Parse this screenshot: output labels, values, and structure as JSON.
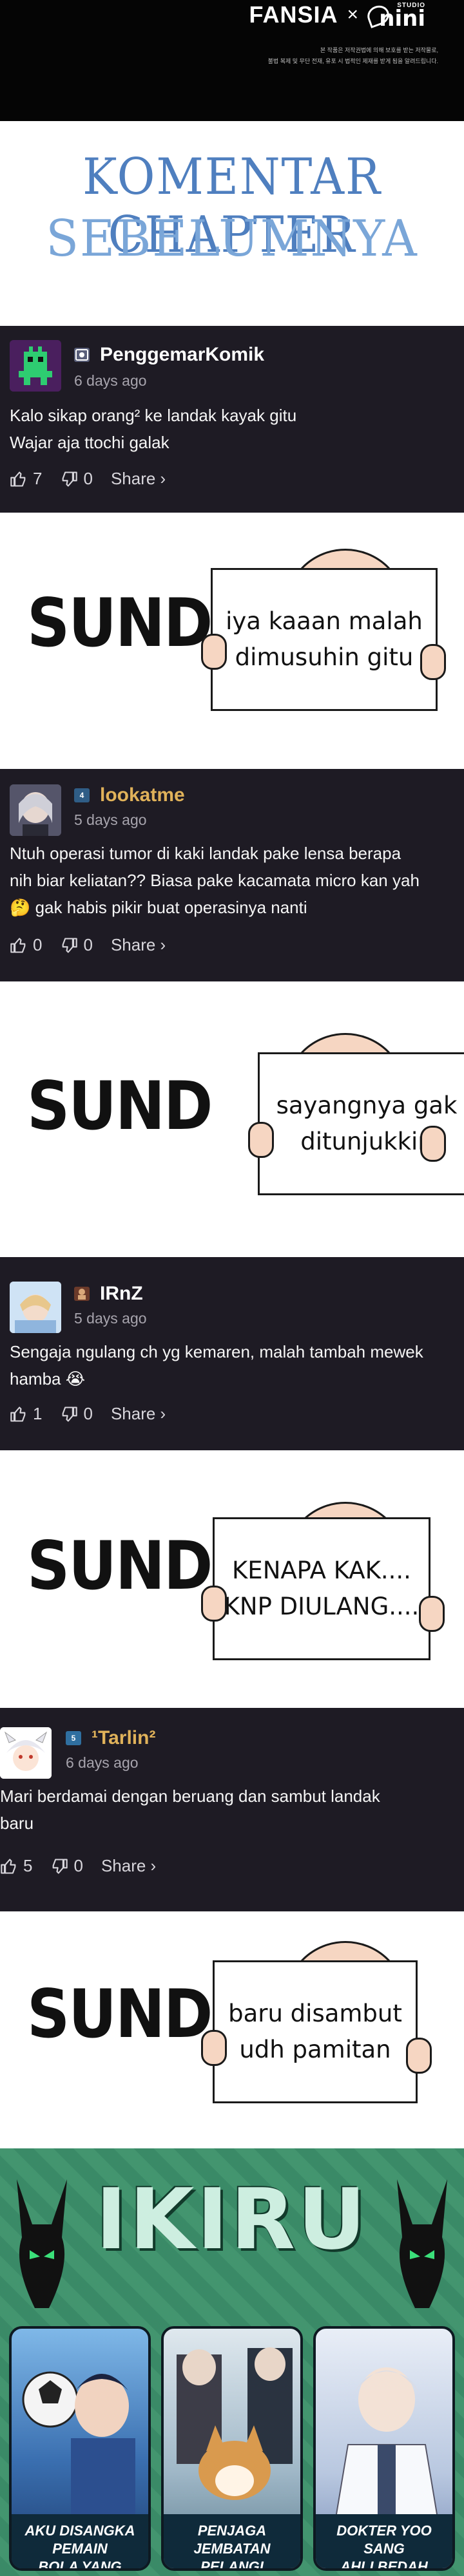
{
  "banner": {
    "brand": "FANSIA",
    "separator": "×",
    "studio_top": "STUDIO",
    "studio_name": "nini",
    "notes": [
      "본 작품은 저작권법에 의해 보호를 받는 저작물로,",
      "불법 복제 및 무단 전재, 유포 시 법적인 제재를 받게 됨을 알려드립니다."
    ]
  },
  "title": {
    "line1": "KOMENTAR CHAPTER",
    "line2": "SEBELUMNYA"
  },
  "comments": [
    {
      "username": "PenggemarKomik",
      "age": "6 days ago",
      "text": [
        "Kalo sikap orang² ke landak kayak gitu",
        "Wajar aja ttochi galak"
      ],
      "likes": "7",
      "dislikes": "0",
      "share": "Share ›",
      "name_color": "#ffffff",
      "badge": "",
      "badge_color": "#5a5f7a"
    },
    {
      "username": "lookatme",
      "age": "5 days ago",
      "text": [
        "Ntuh operasi tumor di kaki landak pake lensa berapa",
        "nih biar keliatan?? Biasa pake kacamata micro kan yah",
        "🤔 gak habis pikir buat operasinya nanti"
      ],
      "likes": "0",
      "dislikes": "0",
      "share": "Share ›",
      "name_color": "#e0b25a",
      "badge": "4",
      "badge_color": "#2f5d86"
    },
    {
      "username": "IRnZ",
      "age": "5 days ago",
      "text": [
        "Sengaja ngulang ch yg kemaren, malah tambah mewek",
        "hamba 😭"
      ],
      "likes": "1",
      "dislikes": "0",
      "share": "Share ›",
      "name_color": "#ffffff",
      "badge": "",
      "badge_color": "#6b3a2a"
    },
    {
      "username": "¹Tarlin²",
      "age": "6 days ago",
      "text": [
        "Mari berdamai dengan beruang dan sambut landak",
        "baru"
      ],
      "likes": "5",
      "dislikes": "0",
      "share": "Share ›",
      "name_color": "#e0b25a",
      "badge": "5",
      "badge_color": "#2f6fa0"
    }
  ],
  "signs": [
    {
      "sund": "SUND",
      "text": [
        "iya kaaan malah",
        "dimusuhin gitu"
      ]
    },
    {
      "sund": "SUND",
      "text": [
        "sayangnya gak",
        "ditunjukkin"
      ]
    },
    {
      "sund": "SUND",
      "text": [
        "KENAPA KAK....",
        "KNP DIULANG...."
      ]
    },
    {
      "sund": "SUND",
      "text": [
        "baru disambut",
        "udh pamitan"
      ]
    }
  ],
  "promo": {
    "logo": "IKIRU",
    "cards": [
      {
        "title": [
          "AKU DISANGKA PEMAIN",
          "BOLA YANG JENIUS"
        ]
      },
      {
        "title": [
          "PENJAGA JEMBATAN",
          "PELANGI"
        ]
      },
      {
        "title": [
          "DOKTER YOO SANG",
          "AHLI BEDAH"
        ]
      }
    ]
  },
  "colors": {
    "comment_bg": "#1e1b24",
    "title_blue": "#4f7fbf",
    "promo_green": "#3f8f6c"
  }
}
